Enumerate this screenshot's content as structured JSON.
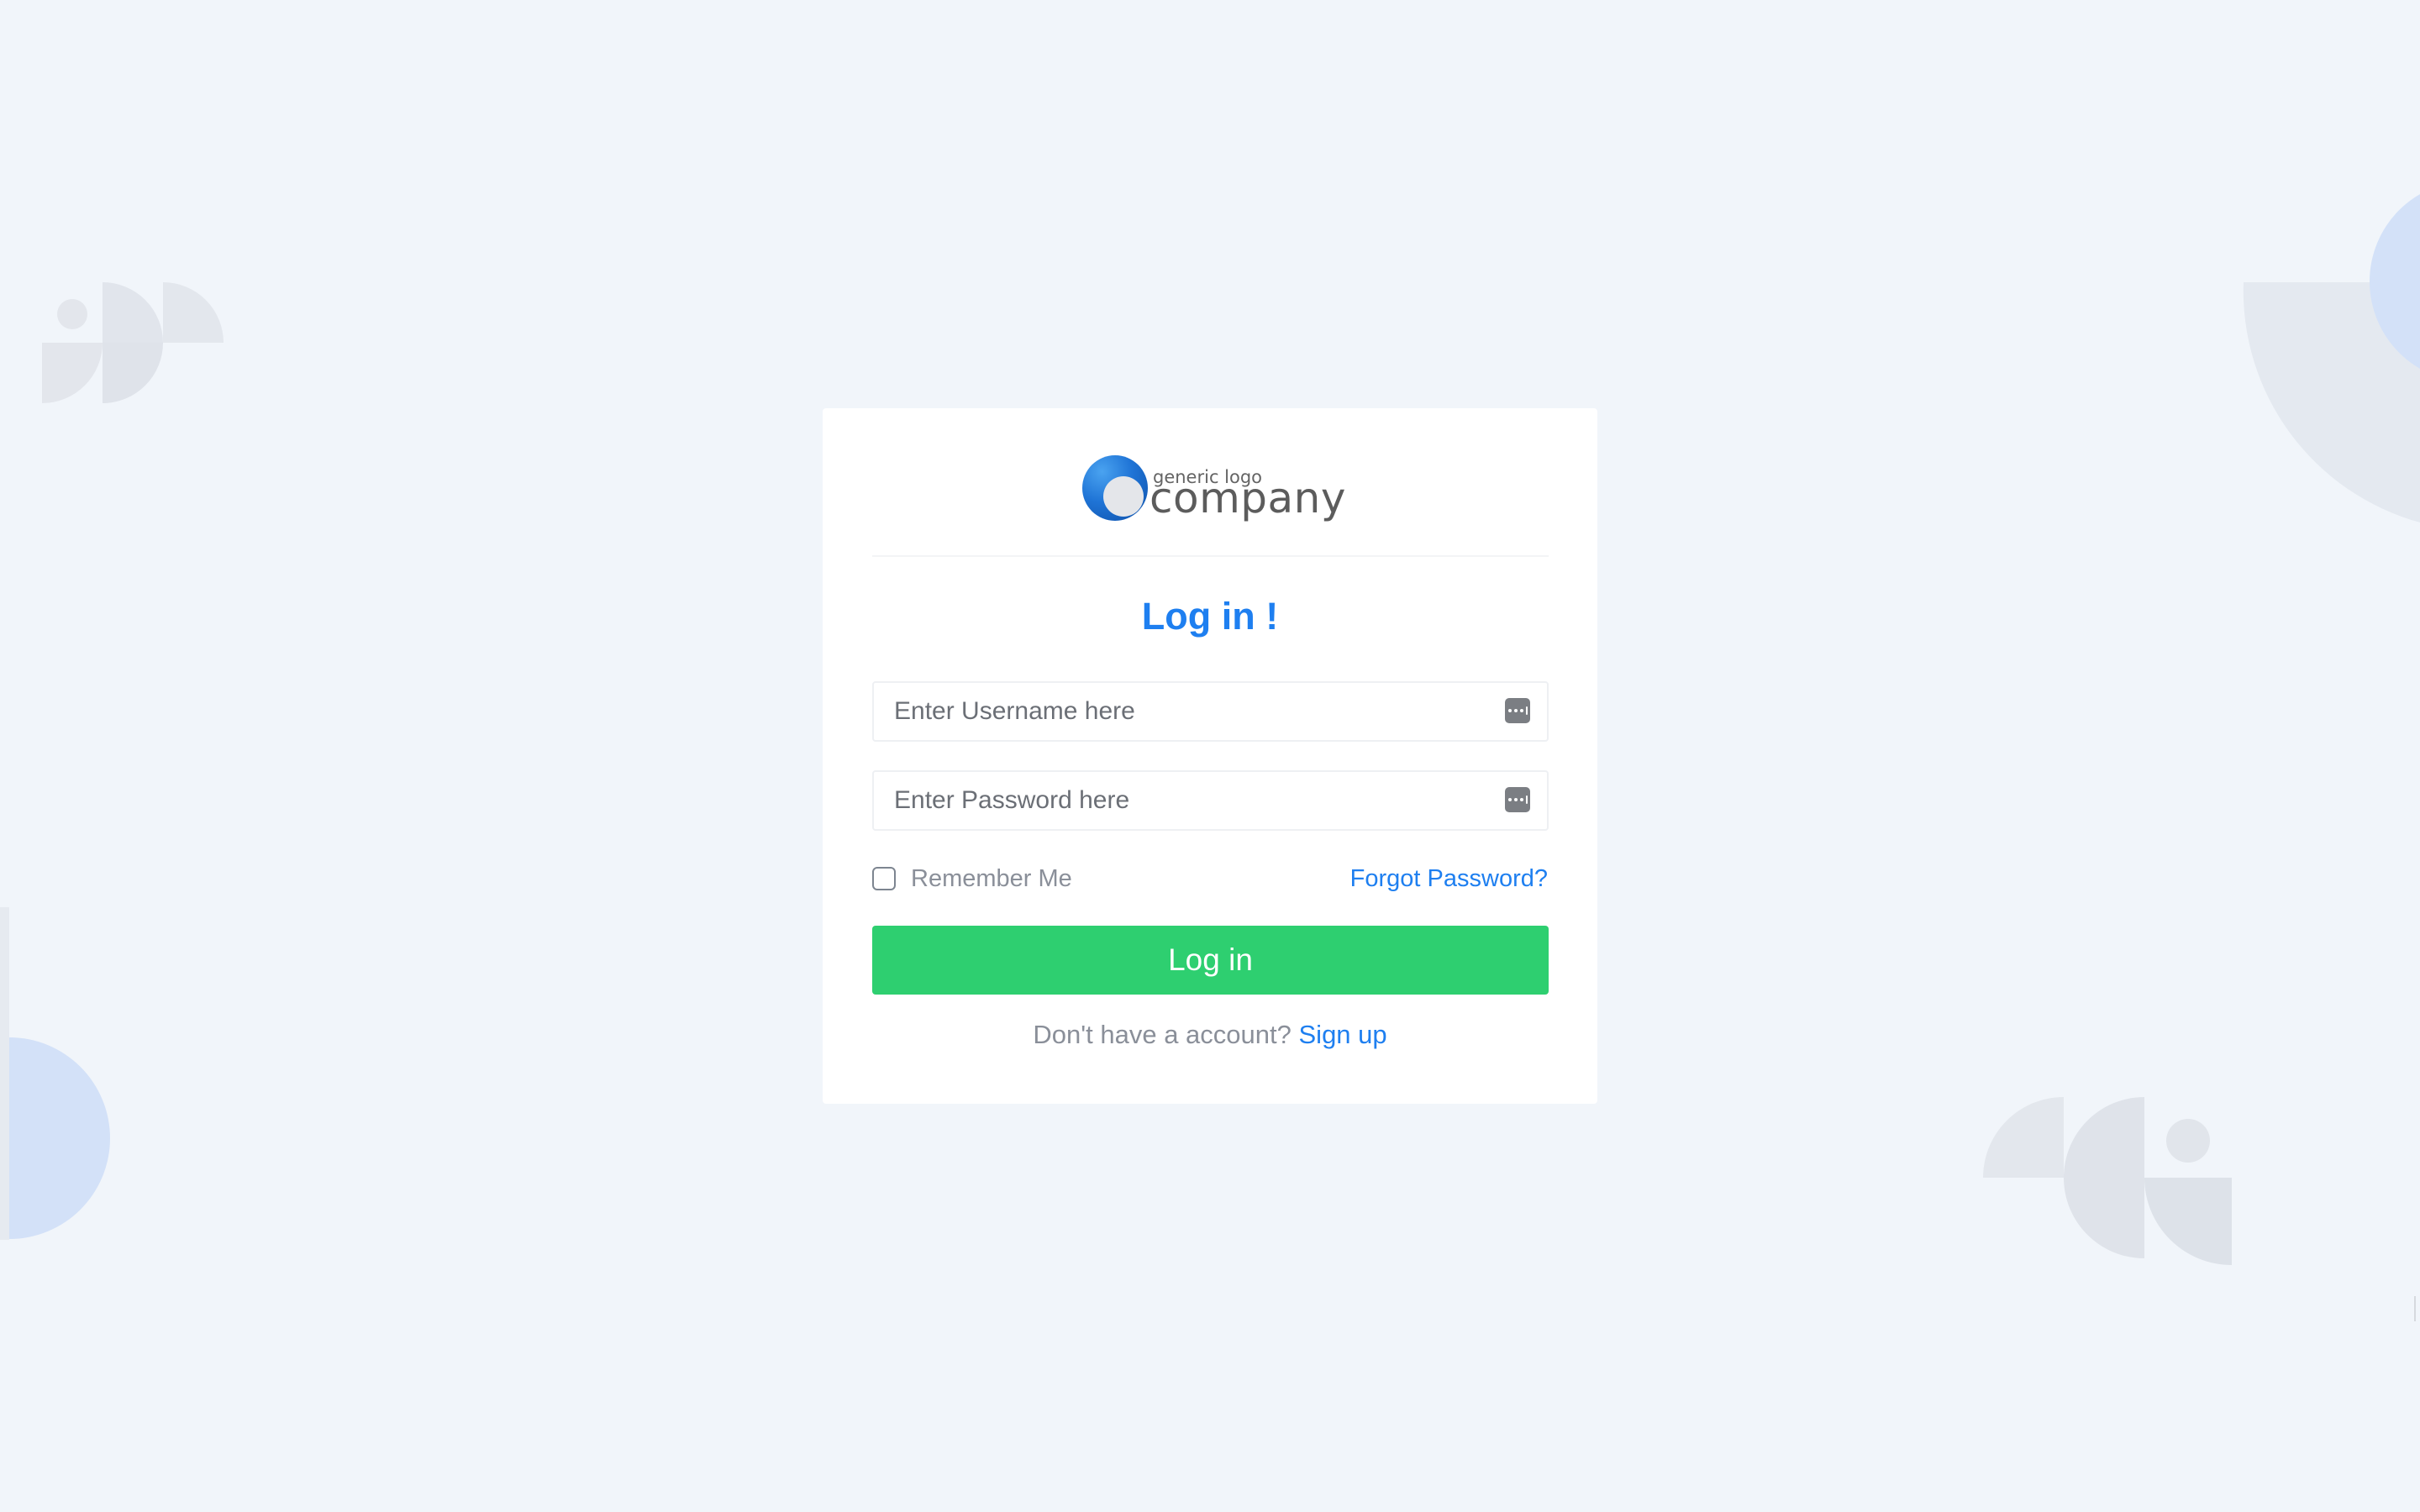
{
  "brand": {
    "logo_small": "generic logo",
    "logo_big": "company",
    "logo_color": "#1f74d6"
  },
  "login_form": {
    "title": "Log in !",
    "username": {
      "value": "",
      "placeholder": "Enter Username here",
      "icon": "password-manager-icon"
    },
    "password": {
      "value": "",
      "placeholder": "Enter Password here",
      "icon": "password-manager-icon"
    },
    "remember_me": {
      "label": "Remember Me",
      "checked": false
    },
    "forgot_password_label": "Forgot Password?",
    "submit_label": "Log in",
    "signup_prompt": "Don't have a account?",
    "signup_link": "Sign up"
  },
  "colors": {
    "background": "#f1f5fa",
    "accent": "#1e7ff0",
    "button": "#2ecf70",
    "decor_gray": "#e3e7ee",
    "decor_blue": "#d3e1f8"
  }
}
